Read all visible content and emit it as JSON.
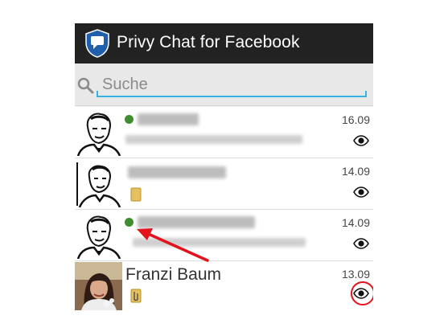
{
  "app": {
    "title": "Privy Chat for Facebook",
    "icon": "shield-chat-icon"
  },
  "search": {
    "placeholder": "Suche",
    "value": ""
  },
  "conversations": [
    {
      "name": "",
      "name_blurred": true,
      "preview_blurred": true,
      "online": true,
      "date": "16.09",
      "status_icon": "eye-icon"
    },
    {
      "name": "",
      "name_blurred": true,
      "preview_blurred": false,
      "attachment": true,
      "online": false,
      "date": "14.09",
      "status_icon": "eye-icon"
    },
    {
      "name": "",
      "name_blurred": true,
      "preview_blurred": true,
      "online": true,
      "date": "14.09",
      "status_icon": "eye-icon"
    },
    {
      "name": "Franzi Baum",
      "name_blurred": false,
      "attachment": true,
      "online": false,
      "date": "13.09",
      "status_icon": "eye-icon",
      "highlighted": true
    }
  ],
  "colors": {
    "actionbar": "#222222",
    "search_accent": "#33b5e5",
    "online": "#3f8e2e",
    "annotation": "#e3121d"
  }
}
